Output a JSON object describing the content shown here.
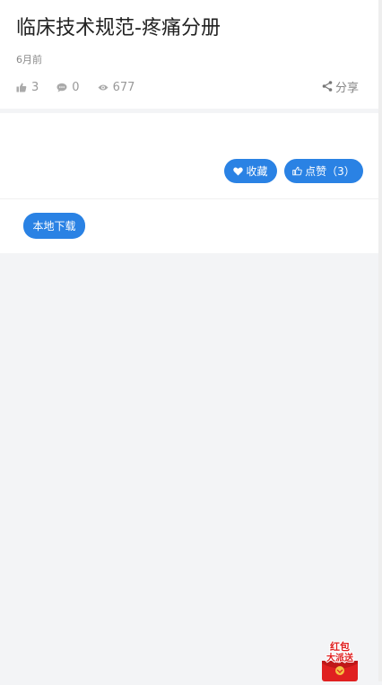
{
  "article": {
    "title": "临床技术规范-疼痛分册",
    "time": "6月前"
  },
  "stats": {
    "likes": "3",
    "comments": "0",
    "views": "677"
  },
  "actions": {
    "share_label": "分享",
    "favorite_label": "收藏",
    "like_label": "点赞（3）",
    "download_label": "本地下载"
  },
  "floating": {
    "redpacket_line1": "红包",
    "redpacket_line2": "大派送"
  },
  "colors": {
    "accent": "#2a82e4",
    "background": "#f3f4f6",
    "card": "#ffffff",
    "redpacket": "#e02020"
  }
}
